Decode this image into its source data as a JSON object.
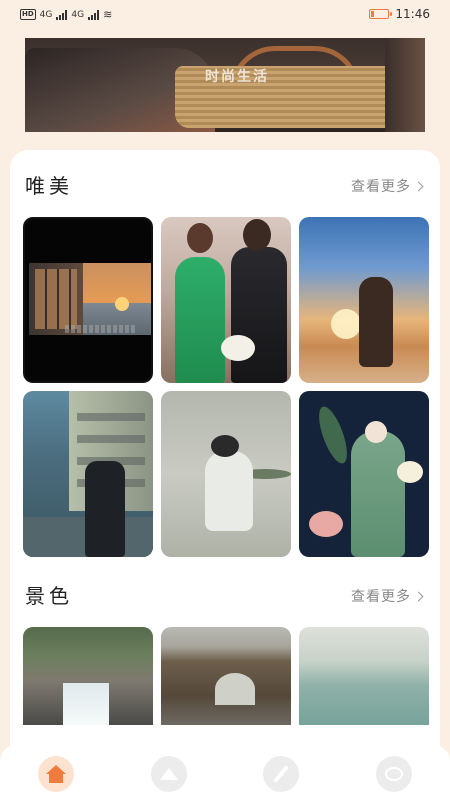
{
  "status_bar": {
    "hd": "HD",
    "sim1": "4G",
    "sim2": "4G",
    "time": "11:46",
    "battery_level": 0.2,
    "battery_color": "#f07b3f"
  },
  "banner": {
    "overlay_text": "时尚生活"
  },
  "sections": [
    {
      "title": "唯美",
      "more_label": "查看更多"
    },
    {
      "title": "景色",
      "more_label": "查看更多"
    }
  ],
  "bottom_nav": {
    "items": [
      {
        "icon": "home-icon",
        "active": true
      },
      {
        "icon": "mountain-icon",
        "active": false
      },
      {
        "icon": "pen-icon",
        "active": false
      },
      {
        "icon": "face-icon",
        "active": false
      }
    ],
    "accent": "#f07b3f"
  }
}
